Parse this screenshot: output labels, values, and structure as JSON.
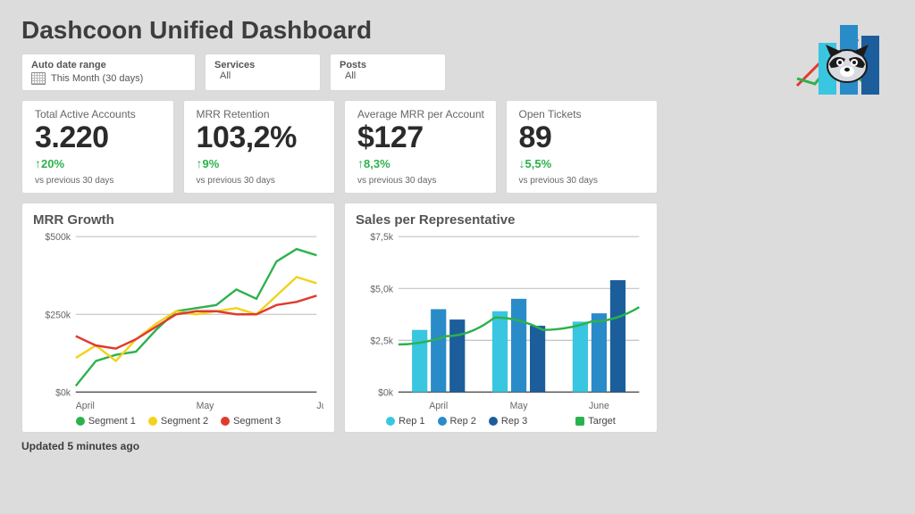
{
  "title": "Dashcoon Unified Dashboard",
  "filters": {
    "date_range": {
      "label": "Auto  date range",
      "value": "This Month (30 days)"
    },
    "services": {
      "label": "Services",
      "value": "All"
    },
    "posts": {
      "label": "Posts",
      "value": "All"
    }
  },
  "kpis": [
    {
      "label": "Total Active Accounts",
      "value": "3.220",
      "delta_dir": "up",
      "delta": "20%",
      "compare": "vs previous 30 days"
    },
    {
      "label": "MRR Retention",
      "value": "103,2%",
      "delta_dir": "up",
      "delta": "9%",
      "compare": "vs previous 30 days"
    },
    {
      "label": "Average MRR per  Account",
      "value": "$127",
      "delta_dir": "up",
      "delta": "8,3%",
      "compare": "vs previous 30 days"
    },
    {
      "label": "Open Tickets",
      "value": "89",
      "delta_dir": "down",
      "delta": "5,5%",
      "compare": "vs previous 30 days"
    }
  ],
  "updated": "Updated 5 minutes ago",
  "colors": {
    "green": "#2bb24c",
    "yellow": "#f2d21b",
    "red": "#e03a2f",
    "cyan": "#39c6e0",
    "midblue": "#2a8bc9",
    "darkblue": "#1c5e9c"
  },
  "chart_data": [
    {
      "id": "mrr_growth",
      "type": "line",
      "title": "MRR  Growth",
      "xlabel": "",
      "ylabel": "",
      "x_ticks": [
        "April",
        "May",
        "June"
      ],
      "y_ticks": [
        "$0k",
        "$250k",
        "$500k"
      ],
      "ylim": [
        0,
        500
      ],
      "x": [
        0,
        1,
        2,
        3,
        4,
        5,
        6,
        7,
        8,
        9,
        10,
        11,
        12
      ],
      "series": [
        {
          "name": "Segment 1",
          "color_key": "green",
          "values": [
            20,
            100,
            120,
            130,
            200,
            260,
            270,
            280,
            330,
            300,
            420,
            460,
            440
          ]
        },
        {
          "name": "Segment 2",
          "color_key": "yellow",
          "values": [
            110,
            150,
            100,
            170,
            220,
            260,
            250,
            260,
            270,
            250,
            310,
            370,
            350
          ]
        },
        {
          "name": "Segment 3",
          "color_key": "red",
          "values": [
            180,
            150,
            140,
            170,
            210,
            250,
            260,
            260,
            250,
            250,
            280,
            290,
            310
          ]
        }
      ],
      "legend": [
        "Segment 1",
        "Segment 2",
        "Segment 3"
      ]
    },
    {
      "id": "sales_per_rep",
      "type": "bar",
      "title": "Sales per Representative",
      "xlabel": "",
      "ylabel": "",
      "categories": [
        "April",
        "May",
        "June"
      ],
      "y_ticks": [
        "$0k",
        "$2,5k",
        "$5,0k",
        "$7,5k"
      ],
      "ylim": [
        0,
        7.5
      ],
      "series": [
        {
          "name": "Rep 1",
          "color_key": "cyan",
          "values": [
            3.0,
            3.9,
            3.4
          ]
        },
        {
          "name": "Rep 2",
          "color_key": "midblue",
          "values": [
            4.0,
            4.5,
            3.8
          ]
        },
        {
          "name": "Rep 3",
          "color_key": "darkblue",
          "values": [
            3.5,
            3.2,
            5.4
          ]
        }
      ],
      "target": {
        "name": "Target",
        "color_key": "green",
        "values": [
          2.3,
          2.7,
          3.6,
          3.0,
          3.4,
          4.1
        ]
      },
      "legend": [
        "Rep 1",
        "Rep 2",
        "Rep 3",
        "Target"
      ]
    }
  ]
}
